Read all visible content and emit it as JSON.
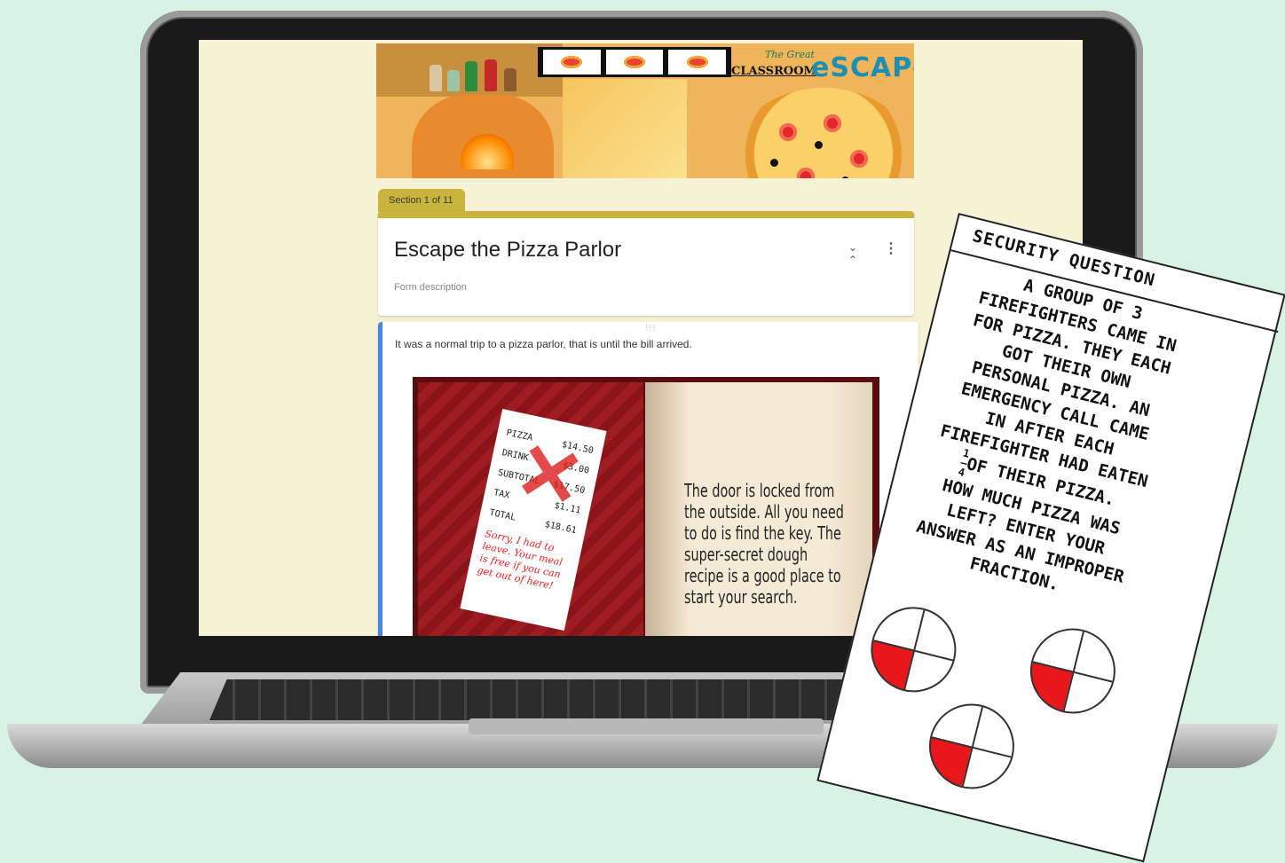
{
  "banner": {
    "logo_the_great": "The Great",
    "logo_classroom": "CLASSROOM",
    "logo_escape": "eSCAPe"
  },
  "form": {
    "section_tab": "Section 1 of 11",
    "title": "Escape the Pizza Parlor",
    "description_placeholder": "Form description",
    "collapse_icon": "collapse-icon",
    "more_icon": "more-vertical-icon",
    "drag_handle": "⁝⁝⁝",
    "item_text": "It was a normal trip to a pizza parlor, that is until the bill arrived."
  },
  "receipt": {
    "rows": [
      {
        "label": "PIZZA",
        "value": "$14.50"
      },
      {
        "label": "DRINK",
        "value": "$3.00"
      },
      {
        "label": "SUBTOTAL",
        "value": "$17.50"
      },
      {
        "label": "TAX",
        "value": "$1.11"
      },
      {
        "label": "TOTAL",
        "value": "$18.61"
      }
    ],
    "note": "Sorry, I had to leave. Your meal is free if you can get out of here!"
  },
  "book_note": "The door is locked from the outside. All you need to do is find the key. The super-secret dough recipe is a good place to start your search.",
  "security_card": {
    "heading": "SECURITY QUESTION",
    "lines": [
      "A GROUP OF 3",
      "FIREFIGHTERS CAME IN",
      "FOR PIZZA. THEY EACH",
      "GOT THEIR OWN",
      "PERSONAL PIZZA. AN",
      "EMERGENCY CALL CAME",
      "IN AFTER EACH",
      "FIREFIGHTER HAD EATEN"
    ],
    "fraction_num": "1",
    "fraction_den": "4",
    "fraction_line": "OF THEIR PIZZA.",
    "lines_after": [
      "HOW MUCH PIZZA WAS",
      "LEFT? ENTER YOUR",
      "ANSWER AS AN IMPROPER",
      "FRACTION."
    ]
  },
  "colors": {
    "section_accent": "#c9b43e",
    "active_item_border": "#4a86f0",
    "pizza_red": "#e8171b"
  }
}
